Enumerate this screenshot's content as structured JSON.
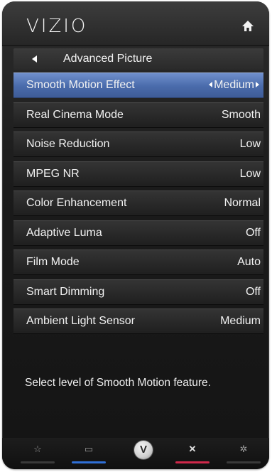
{
  "header": {
    "brand": "VIZIO",
    "home_icon": "home-icon"
  },
  "breadcrumb": {
    "back_icon": "back-arrow-icon",
    "label": "Advanced Picture"
  },
  "menu": {
    "items": [
      {
        "label": "Smooth Motion Effect",
        "value": "Medium",
        "selected": true
      },
      {
        "label": "Real Cinema Mode",
        "value": "Smooth"
      },
      {
        "label": "Noise Reduction",
        "value": "Low"
      },
      {
        "label": "MPEG NR",
        "value": "Low"
      },
      {
        "label": "Color Enhancement",
        "value": "Normal"
      },
      {
        "label": "Adaptive Luma",
        "value": "Off"
      },
      {
        "label": "Film Mode",
        "value": "Auto"
      },
      {
        "label": "Smart Dimming",
        "value": "Off"
      },
      {
        "label": "Ambient Light Sensor",
        "value": "Medium"
      }
    ]
  },
  "help": {
    "text": "Select level of Smooth Motion feature."
  },
  "footer": {
    "buttons": [
      {
        "icon": "star-icon",
        "glyph": "☆",
        "color": "#3a3a3a"
      },
      {
        "icon": "widescreen-icon",
        "glyph": "▭",
        "color": "#2f6fd6"
      },
      {
        "icon": "vizio-v-icon",
        "glyph": "V",
        "color": ""
      },
      {
        "icon": "close-icon",
        "glyph": "✕",
        "color": "#d0284a"
      },
      {
        "icon": "gear-icon",
        "glyph": "✲",
        "color": "#3a3a3a"
      }
    ]
  },
  "colors": {
    "selected_row": "#4a6bab",
    "blue_bar": "#2f6fd6",
    "red_bar": "#d0284a"
  }
}
